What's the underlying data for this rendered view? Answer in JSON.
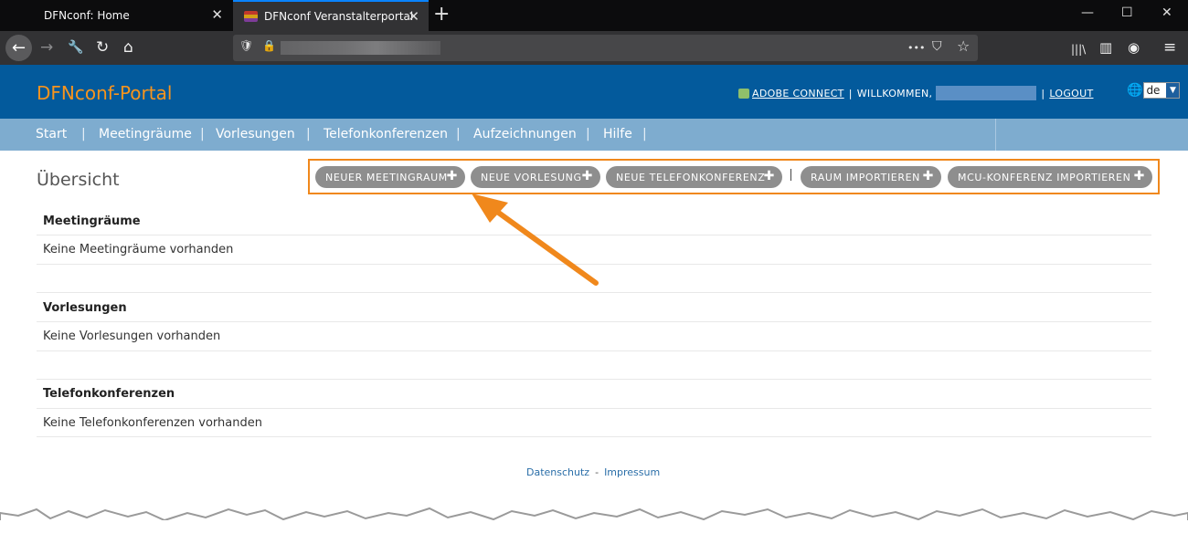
{
  "browser": {
    "tabs": [
      {
        "title": "DFNconf: Home",
        "close": "✕"
      },
      {
        "title": "DFNconf Veranstalterportal",
        "close": "✕"
      }
    ],
    "new_tab": "+",
    "window_controls": {
      "minimize": "—",
      "maximize": "☐",
      "close": "✕"
    },
    "nav_icons": {
      "back": "←",
      "forward": "→",
      "tools": "🔧",
      "reload": "↻",
      "home": "⌂",
      "shield": "🛡",
      "lock": "🔒",
      "more": "•••",
      "pocket": "⛉",
      "star": "☆",
      "library": "|||\\",
      "sidebar": "▥",
      "account": "◉",
      "menu": "≡"
    }
  },
  "site": {
    "logo": "DFNconf-Portal",
    "adobe_connect": "ADOBE CONNECT",
    "separator": "|",
    "welcome": "WILLKOMMEN,",
    "logout": "LOGOUT",
    "language": "de",
    "globe": "🌐",
    "dropdown_arrow": "▼"
  },
  "menu": {
    "items": [
      "Start",
      "Meetingräume",
      "Vorlesungen",
      "Telefonkonferenzen",
      "Aufzeichnungen",
      "Hilfe"
    ],
    "separator": "|"
  },
  "page": {
    "title": "Übersicht",
    "actions": [
      {
        "label": "NEUER MEETINGRAUM",
        "plus": "✚"
      },
      {
        "label": "NEUE VORLESUNG",
        "plus": "✚"
      },
      {
        "label": "NEUE TELEFONKONFERENZ",
        "plus": "✚"
      },
      {
        "label": "RAUM IMPORTIEREN",
        "plus": "✚"
      },
      {
        "label": "MCU-KONFERENZ IMPORTIEREN",
        "plus": "✚"
      }
    ],
    "sections": [
      {
        "heading": "Meetingräume",
        "text": "Keine Meetingräume vorhanden"
      },
      {
        "heading": "Vorlesungen",
        "text": "Keine Vorlesungen vorhanden"
      },
      {
        "heading": "Telefonkonferenzen",
        "text": "Keine Telefonkonferenzen vorhanden"
      }
    ]
  },
  "footer": {
    "privacy": "Datenschutz",
    "dash": "-",
    "imprint": "Impressum"
  },
  "colors": {
    "brand_blue": "#035a9c",
    "menu_blue": "#7eaccf",
    "logo_orange": "#f7941d",
    "highlight_orange": "#f0881c",
    "button_gray": "#8e8e8e"
  }
}
